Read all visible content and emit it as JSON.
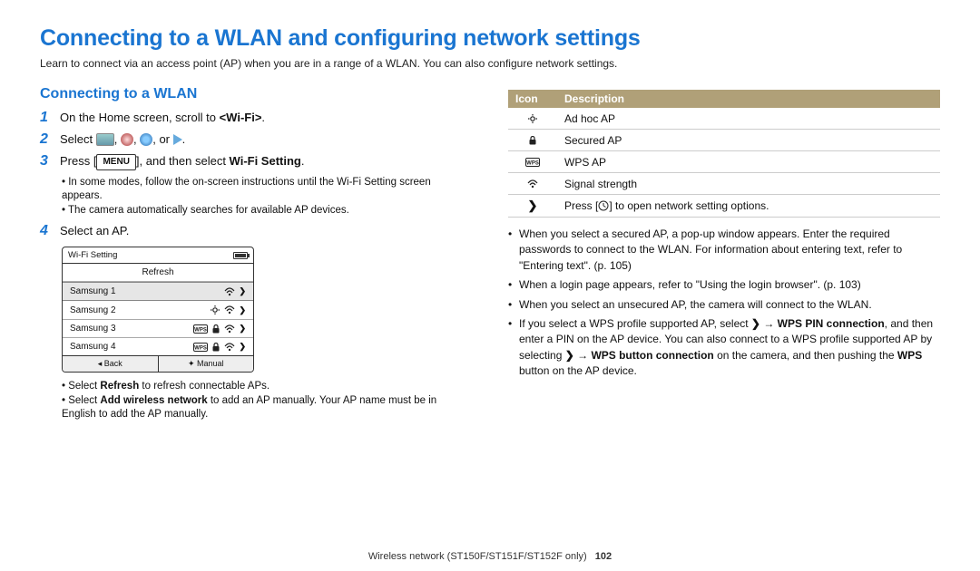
{
  "title": "Connecting to a WLAN and configuring network settings",
  "intro": "Learn to connect via an access point (AP) when you are in a range of a WLAN. You can also configure network settings.",
  "section_heading": "Connecting to a WLAN",
  "steps": {
    "s1": {
      "num": "1",
      "pre": "On the Home screen, scroll to ",
      "bold": "<Wi-Fi>",
      "post": "."
    },
    "s2": {
      "num": "2",
      "text": "Select ",
      "or": ", or ",
      "end": "."
    },
    "s3": {
      "num": "3",
      "pre": "Press [",
      "menu": "MENU",
      "mid": "], and then select ",
      "bold": "Wi-Fi Setting",
      "post": "."
    },
    "s3_subs": [
      "In some modes, follow the on-screen instructions until the Wi-Fi Setting screen appears.",
      "The camera automatically searches for available AP devices."
    ],
    "s4": {
      "num": "4",
      "text": "Select an AP."
    },
    "s4_subs_a": {
      "pre": "Select ",
      "b": "Refresh",
      "post": " to refresh connectable APs."
    },
    "s4_subs_b": {
      "pre": "Select ",
      "b": "Add wireless network",
      "post": " to add an AP manually. Your AP name must be in English to add the AP manually."
    }
  },
  "wifi_box": {
    "title": "Wi-Fi Setting",
    "refresh": "Refresh",
    "rows": [
      {
        "name": "Samsung 1",
        "icons": [
          "wifi",
          "chev"
        ],
        "sel": true
      },
      {
        "name": "Samsung 2",
        "icons": [
          "adhoc",
          "wifi",
          "chev"
        ],
        "sel": false
      },
      {
        "name": "Samsung 3",
        "icons": [
          "wps",
          "lock",
          "wifi",
          "chev"
        ],
        "sel": false
      },
      {
        "name": "Samsung 4",
        "icons": [
          "wps",
          "lock",
          "wifi",
          "chev"
        ],
        "sel": false
      }
    ],
    "foot_l": "Back",
    "foot_r": "Manual"
  },
  "table": {
    "h1": "Icon",
    "h2": "Description",
    "rows": [
      {
        "icon": "adhoc",
        "desc": "Ad hoc AP"
      },
      {
        "icon": "lock",
        "desc": "Secured AP"
      },
      {
        "icon": "wps",
        "desc": "WPS AP"
      },
      {
        "icon": "wifi",
        "desc": "Signal strength"
      },
      {
        "icon": "chev",
        "desc_pre": "Press [",
        "desc_mid": "] to open network setting options."
      }
    ]
  },
  "right_bullets": {
    "b1": "When you select a secured AP, a pop-up window appears. Enter the required passwords to connect to the WLAN. For information about entering text, refer to \"Entering text\". (p. 105)",
    "b2": "When a login page appears, refer to \"Using the login browser\". (p. 103)",
    "b3": "When you select an unsecured AP, the camera will connect to the WLAN.",
    "b4_pre": "If you select a WPS profile supported AP, select ",
    "b4_arrow": " → ",
    "b4_bold1": "WPS PIN connection",
    "b4_mid": ", and then enter a PIN on the AP device. You can also connect to a WPS profile supported AP by selecting ",
    "b4_bold2": "WPS button connection",
    "b4_mid2": " on the camera, and then pushing the ",
    "b4_bold3": "WPS",
    "b4_end": " button on the AP device."
  },
  "footer": {
    "text": "Wireless network  (ST150F/ST151F/ST152F only)",
    "page": "102"
  }
}
